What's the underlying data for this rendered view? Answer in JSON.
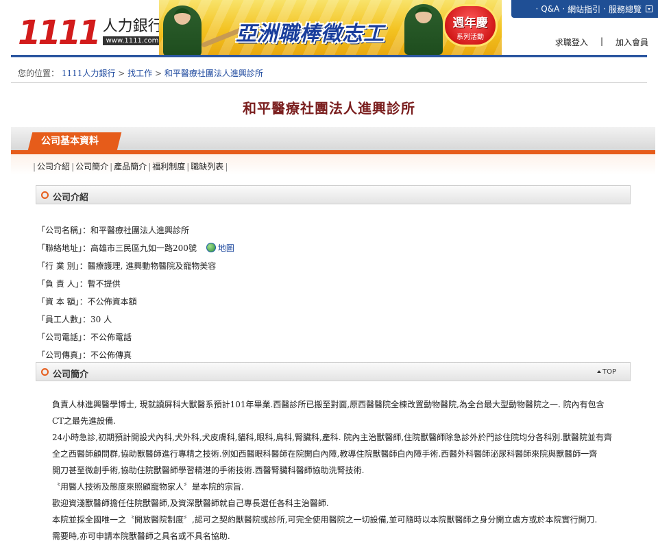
{
  "header": {
    "logo_number": "1111",
    "logo_title": "人力銀行",
    "logo_url": "www.1111.com.tw",
    "banner_text": "亞洲職棒徵志工",
    "anniversary_main": "週年慶",
    "anniversary_sub": "系列活動",
    "topnav": [
      "Q&A",
      "網站指引",
      "服務總覽"
    ],
    "member_login": "求職登入",
    "member_divider": "|",
    "member_join": "加入會員"
  },
  "breadcrumb": {
    "prefix": "您的位置：",
    "items": [
      "1111人力銀行",
      "找工作",
      "和平醫療社團法人進興診所"
    ],
    "separator": ">"
  },
  "company_title": "和平醫療社團法人進興診所",
  "section": {
    "tab_label": "公司基本資料",
    "subnav": [
      "公司介紹",
      "公司簡介",
      "產品簡介",
      "福利制度",
      "職缺列表"
    ]
  },
  "intro_box": {
    "title": "公司介紹"
  },
  "info": [
    {
      "label": "「公司名稱」：",
      "value": "和平醫療社團法人進興診所"
    },
    {
      "label": "「聯絡地址」：",
      "value": "高雄市三民區九如一路200號",
      "link": "地圖"
    },
    {
      "label": "「行 業 別」：",
      "value": "醫療護理, 進興動物醫院及寵物美容"
    },
    {
      "label": "「負 責 人」：",
      "value": "暫不提供"
    },
    {
      "label": "「資 本 額」：",
      "value": "不公佈資本額"
    },
    {
      "label": "「員工人數」：",
      "value": "30 人"
    },
    {
      "label": "「公司電話」：",
      "value": "不公佈電話"
    },
    {
      "label": "「公司傳真」：",
      "value": "不公佈傳真"
    }
  ],
  "summary_box": {
    "title": "公司簡介",
    "top_link": "TOP"
  },
  "summary_lines": [
    "負責人林進興醫學博士, 現就讀屏科大獸醫系預計101年畢業.西醫診所已搬至對面,原西醫醫院全棟改置動物醫院,為全台最大型動物醫院之一. 院內有包含",
    "CT之最先進設備.",
    "24小時急診,初期預計開設犬內科,犬外科,犬皮膚科,貓科,眼科,鳥科,腎臟科,產科. 院內主治獸醫師,住院獸醫師除急診外於門診住院均分各科別.獸醫院並有齊",
    "全之西醫師顧問群,協助獸醫師進行專精之技術.例如西醫眼科醫師在院開白內障,教導住院獸醫師白內障手術.西醫外科醫師泌尿科醫師來院與獸醫師一齊",
    "開刀甚至微創手術,協助住院獸醫師學習精湛的手術技術.西醫腎臟科醫師協助洗腎技術.",
    "〝用醫人技術及態度來照顧寵物家人〞是本院的宗旨.",
    "歡迎資淺獸醫師擔任住院獸醫師,及資深獸醫師就自己專長選任各科主治醫師.",
    "本院並採全國唯一之〝開放醫院制度〞,認可之契約獸醫院或診所,可完全使用醫院之一切設備,並可隨時以本院獸醫師之身分開立處方或於本院實行開刀.",
    "需要時,亦可申請本院獸醫師之具名或不具名協助."
  ],
  "colors": {
    "brand_red": "#d21b1b",
    "nav_blue": "#1f4f95",
    "accent_orange": "#e65c1a",
    "title_maroon": "#7a1e1e",
    "link_blue": "#1f4a9f"
  }
}
